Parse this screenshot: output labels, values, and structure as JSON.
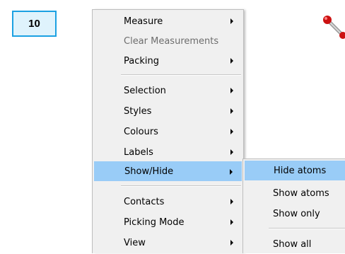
{
  "step_badge": "10",
  "icons": {
    "molecule": "molecule-icon"
  },
  "colors": {
    "highlight": "#99ccf7",
    "badge_border": "#1ba1e2",
    "badge_fill": "#dff3fc"
  },
  "context_menu": {
    "items": [
      {
        "label": "Measure",
        "submenu": true
      },
      {
        "label": "Clear Measurements",
        "disabled": true
      },
      {
        "label": "Packing",
        "submenu": true
      },
      {
        "label": "Selection",
        "submenu": true
      },
      {
        "label": "Styles",
        "submenu": true
      },
      {
        "label": "Colours",
        "submenu": true
      },
      {
        "label": "Labels",
        "submenu": true
      },
      {
        "label": "Show/Hide",
        "submenu": true,
        "highlighted": true
      },
      {
        "label": "Contacts",
        "submenu": true
      },
      {
        "label": "Picking Mode",
        "submenu": true
      },
      {
        "label": "View",
        "submenu": true
      }
    ]
  },
  "showhide_submenu": {
    "items": [
      {
        "label": "Hide atoms",
        "highlighted": true
      },
      {
        "label": "Show atoms"
      },
      {
        "label": "Show only"
      },
      {
        "label": "Show all"
      }
    ]
  }
}
